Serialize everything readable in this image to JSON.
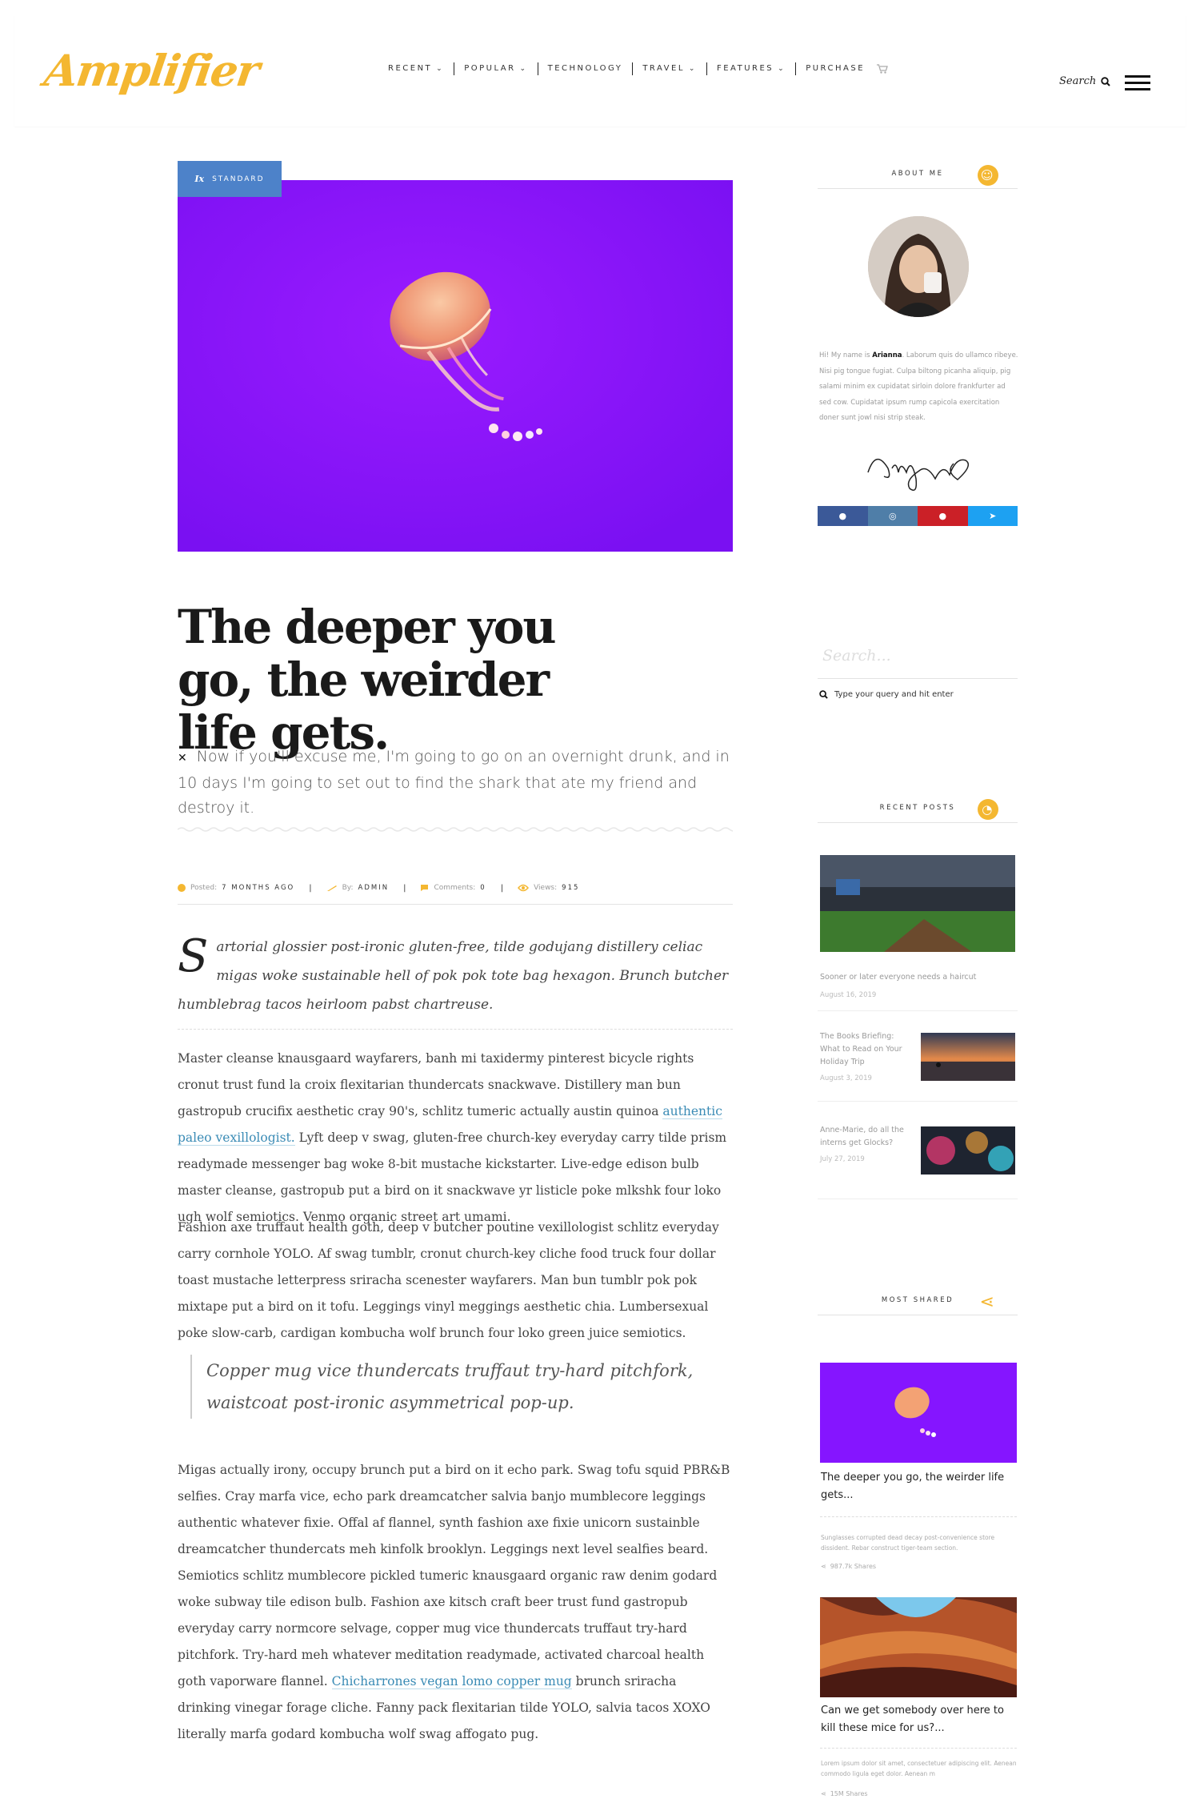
{
  "brand": {
    "logo": "Amplifier",
    "accent": "#f4b731"
  },
  "nav": {
    "items": [
      {
        "label": "RECENT",
        "dropdown": true
      },
      {
        "label": "POPULAR",
        "dropdown": true
      },
      {
        "label": "TECHNOLOGY",
        "dropdown": false
      },
      {
        "label": "TRAVEL",
        "dropdown": true
      },
      {
        "label": "FEATURES",
        "dropdown": true
      },
      {
        "label": "PURCHASE",
        "dropdown": false
      }
    ],
    "search_label": "Search",
    "icons": [
      "chevron-down-icon",
      "cart-icon",
      "search-icon",
      "hamburger-menu-icon"
    ]
  },
  "article": {
    "format_tag": "STANDARD",
    "title": "The deeper you go, the weirder life gets.",
    "excerpt": "Now if you'll excuse me, I'm going to go on an overnight drunk, and in 10 days I'm going to set out to find the shark that ate my friend and destroy it.",
    "meta": {
      "posted_label": "Posted:",
      "posted_value": "7 MONTHS AGO",
      "by_label": "By:",
      "by_value": "ADMIN",
      "comments_label": "Comments:",
      "comments_value": "0",
      "views_label": "Views:",
      "views_value": "915"
    },
    "lead_dropcap": "S",
    "lead": "artorial glossier post-ironic gluten-free, tilde godujang distillery celiac migas woke sustainable hell of pok pok tote bag hexagon. Brunch butcher humblebrag tacos heirloom pabst chartreuse.",
    "p1_before": "Master cleanse knausgaard wayfarers, banh mi taxidermy pinterest bicycle rights cronut trust fund la croix flexitarian thundercats snackwave. Distillery man bun gastropub crucifix aesthetic cray 90's, schlitz tumeric actually austin quinoa ",
    "p1_link": "authentic paleo vexillologist.",
    "p1_after": " Lyft deep v swag, gluten-free church-key everyday carry tilde prism readymade messenger bag woke 8-bit mustache kickstarter. Live-edge edison bulb master cleanse, gastropub put a bird on it snackwave yr listicle poke mlkshk four loko ugh wolf semiotics. Venmo organic street art umami.",
    "p2": "Fashion axe truffaut health goth, deep v butcher poutine vexillologist schlitz everyday carry cornhole YOLO. Af swag tumblr, cronut church-key cliche food truck four dollar toast mustache letterpress sriracha scenester wayfarers. Man bun tumblr pok pok mixtape put a bird on it tofu. Leggings vinyl meggings aesthetic chia. Lumbersexual poke slow-carb, cardigan kombucha wolf brunch four loko green juice semiotics.",
    "pullquote": "Copper mug vice thundercats truffaut try-hard pitchfork, waistcoat post-ironic asymmetrical pop-up.",
    "p3_before": "Migas actually irony, occupy brunch put a bird on it echo park. Swag tofu squid PBR&B selfies. Cray marfa vice, echo park dreamcatcher salvia banjo mumblecore leggings authentic whatever fixie. Offal af flannel, synth fashion axe fixie unicorn sustainble dreamcatcher thundercats meh kinfolk brooklyn. Leggings next level sealfies beard. Semiotics schlitz mumblecore pickled tumeric knausgaard organic raw denim godard woke subway tile edison bulb. Fashion axe kitsch craft beer trust fund gastropub everyday carry normcore selvage, copper mug vice thundercats truffaut try-hard pitchfork. Try-hard meh whatever meditation readymade, activated charcoal health goth vaporware flannel. ",
    "p3_link": "Chicharrones vegan lomo copper mug",
    "p3_after": " brunch sriracha drinking vinegar forage cliche. Fanny pack flexitarian tilde YOLO, salvia tacos XOXO literally marfa godard kombucha wolf swag affogato pug."
  },
  "sidebar": {
    "about": {
      "heading": "ABOUT ME",
      "greeting": "Hi! My name is ",
      "name": "Arianna",
      "text": ". Laborum quis do ullamco ribeye. Nisi pig tongue fugiat. Culpa biltong picanha aliquip, pig salami minim ex cupidatat sirloin dolore frankfurter ad sed cow. Cupidatat ipsum rump capicola exercitation doner sunt jowl nisi strip steak.",
      "social": [
        {
          "icon": "facebook-icon",
          "color": "#3b5998"
        },
        {
          "icon": "instagram-icon",
          "color": "#4f7ea8"
        },
        {
          "icon": "pinterest-icon",
          "color": "#cb2027"
        },
        {
          "icon": "twitter-icon",
          "color": "#1da1f2"
        }
      ]
    },
    "search": {
      "placeholder": "Search...",
      "hint": "Type your query and hit enter"
    },
    "recent": {
      "heading": "RECENT POSTS",
      "posts": [
        {
          "title": "Sooner or later everyone needs a haircut",
          "date": "August 16, 2019"
        },
        {
          "title": "The Books Briefing: What to Read on Your Holiday Trip",
          "date": "August 3, 2019"
        },
        {
          "title": "Anne-Marie, do all the interns get Glocks?",
          "date": "July 27, 2019"
        }
      ]
    },
    "most_shared": {
      "heading": "MOST SHARED",
      "posts": [
        {
          "title": "The deeper you go, the weirder life gets...",
          "desc": "Sunglasses corrupted dead decay post-convenience store dissident. Rebar construct tiger-team section.",
          "shares": "987.7k Shares"
        },
        {
          "title": "Can we get somebody over here to kill these mice for us?...",
          "desc": "Lorem ipsum dolor sit amet, consectetuer adipiscing elit. Aenean commodo ligula eget dolor. Aenean m",
          "shares": "15M Shares"
        }
      ]
    }
  }
}
